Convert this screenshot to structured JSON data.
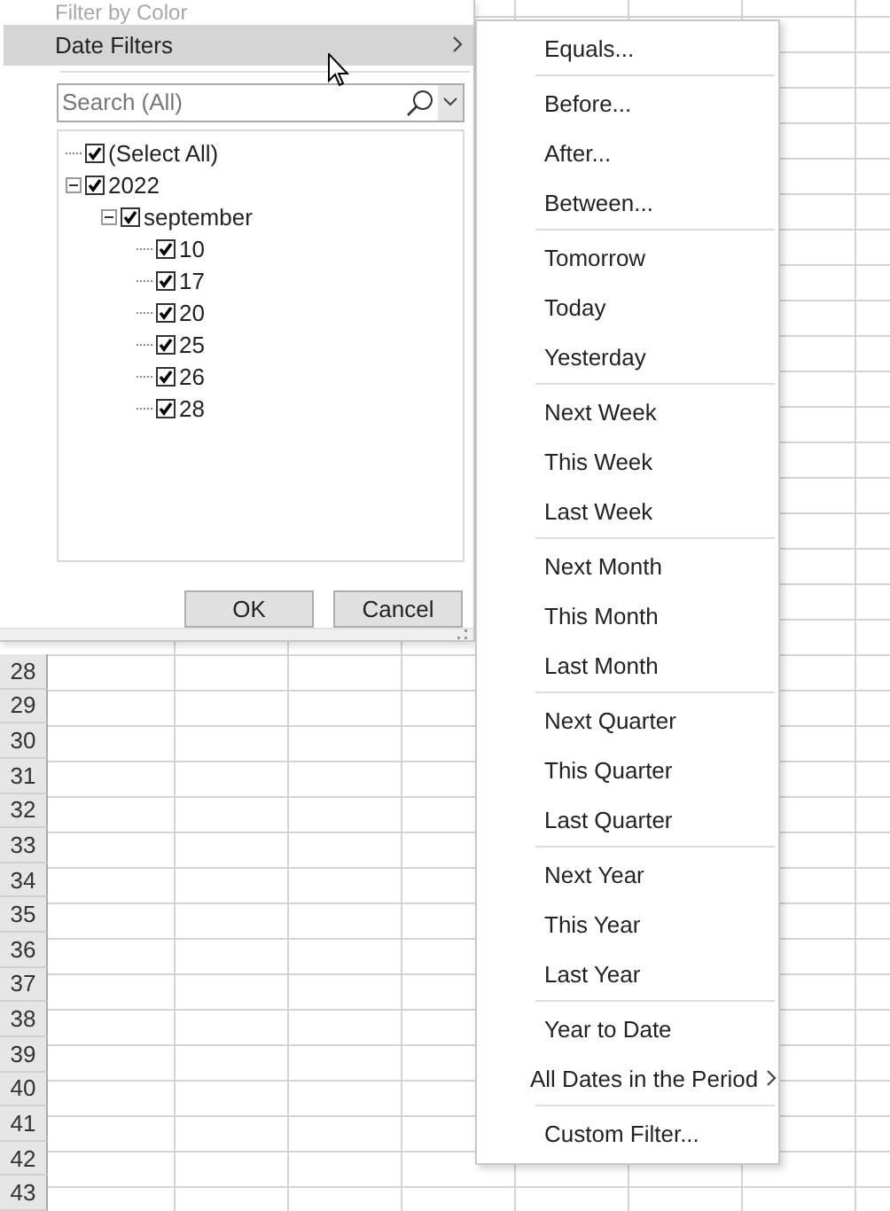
{
  "filter_panel": {
    "items": [
      {
        "label": "Filter by Color",
        "disabled": true,
        "highlighted": false,
        "kind": "submenu"
      },
      {
        "label": "Date Filters",
        "disabled": false,
        "highlighted": true,
        "kind": "submenu"
      }
    ],
    "search": {
      "placeholder": "Search (All)"
    },
    "tree": [
      {
        "label": "(Select All)",
        "checked": true
      },
      {
        "label": "2022",
        "checked": true,
        "expanded": true,
        "children": [
          {
            "label": "september",
            "checked": true,
            "expanded": true,
            "children": [
              {
                "label": "10",
                "checked": true
              },
              {
                "label": "17",
                "checked": true
              },
              {
                "label": "20",
                "checked": true
              },
              {
                "label": "25",
                "checked": true
              },
              {
                "label": "26",
                "checked": true
              },
              {
                "label": "28",
                "checked": true
              }
            ]
          }
        ]
      }
    ],
    "buttons": [
      "OK",
      "Cancel"
    ]
  },
  "date_filters_menu": {
    "groups": [
      [
        {
          "label": "Equals...",
          "kind": "item"
        }
      ],
      [
        {
          "label": "Before...",
          "kind": "item"
        },
        {
          "label": "After...",
          "kind": "item"
        },
        {
          "label": "Between...",
          "kind": "item"
        }
      ],
      [
        {
          "label": "Tomorrow",
          "kind": "item"
        },
        {
          "label": "Today",
          "kind": "item"
        },
        {
          "label": "Yesterday",
          "kind": "item"
        }
      ],
      [
        {
          "label": "Next Week",
          "kind": "item"
        },
        {
          "label": "This Week",
          "kind": "item"
        },
        {
          "label": "Last Week",
          "kind": "item"
        }
      ],
      [
        {
          "label": "Next Month",
          "kind": "item"
        },
        {
          "label": "This Month",
          "kind": "item"
        },
        {
          "label": "Last Month",
          "kind": "item"
        }
      ],
      [
        {
          "label": "Next Quarter",
          "kind": "item"
        },
        {
          "label": "This Quarter",
          "kind": "item"
        },
        {
          "label": "Last Quarter",
          "kind": "item"
        }
      ],
      [
        {
          "label": "Next Year",
          "kind": "item"
        },
        {
          "label": "This Year",
          "kind": "item"
        },
        {
          "label": "Last Year",
          "kind": "item"
        }
      ],
      [
        {
          "label": "Year to Date",
          "kind": "item"
        },
        {
          "label": "All Dates in the Period",
          "kind": "submenu"
        }
      ],
      [
        {
          "label": "Custom Filter...",
          "kind": "item"
        }
      ]
    ]
  },
  "sheet": {
    "row_headers": [
      "28",
      "29",
      "30",
      "31",
      "32",
      "33",
      "34",
      "35",
      "36",
      "37",
      "38",
      "39",
      "40",
      "41",
      "42",
      "43"
    ]
  }
}
